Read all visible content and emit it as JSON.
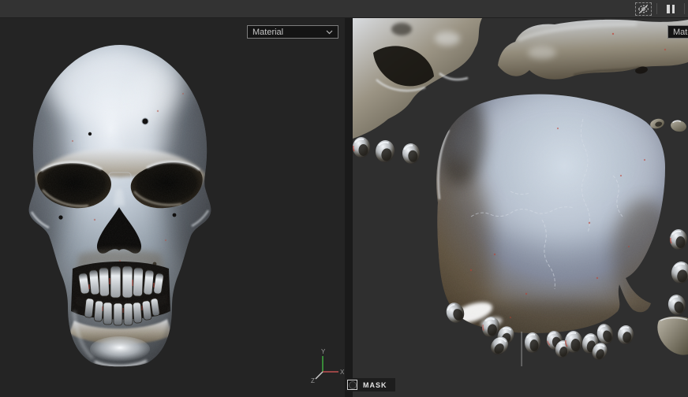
{
  "topbar": {
    "buttons": [
      {
        "name": "visibility-toggle",
        "icon": "eye-slash-icon"
      },
      {
        "name": "pause",
        "icon": "pause-icon"
      }
    ]
  },
  "viewport_3d": {
    "material_mode": "Material",
    "gizmo": {
      "x": "X",
      "y": "Y",
      "z": "Z"
    }
  },
  "viewport_2d": {
    "material_mode": "Material",
    "mask_label": "MASK"
  },
  "colors": {
    "topbar_bg": "#333333",
    "viewport_3d_bg": "#242424",
    "viewport_2d_bg": "#2f2f2f",
    "divider": "#1a1a1a",
    "axis_x": "#c05050",
    "axis_y": "#3da33d",
    "axis_z": "#d0d0d0",
    "accent_red_flecks": "#b03a2e"
  }
}
